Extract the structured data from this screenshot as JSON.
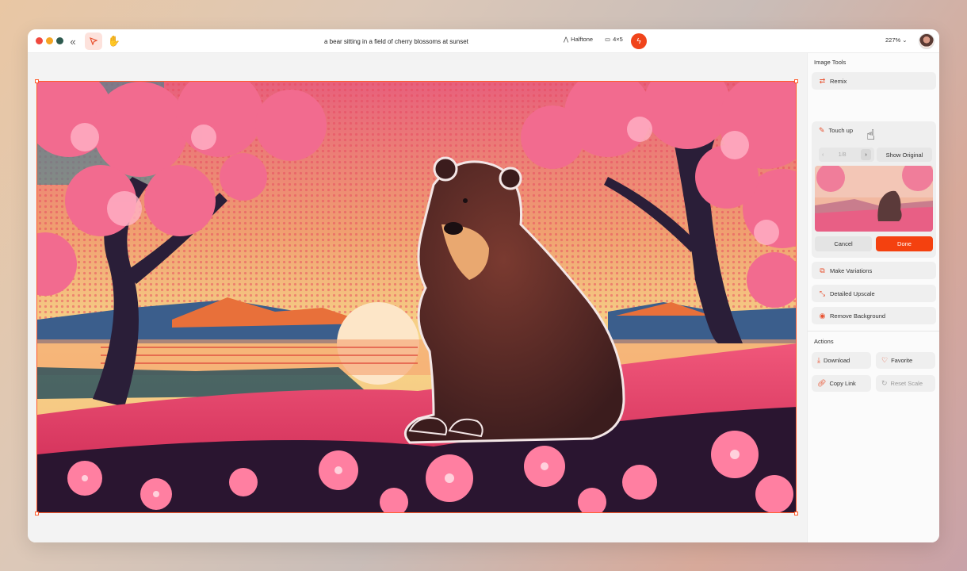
{
  "toolbar": {
    "prompt": "a bear sitting in a field of cherry blossoms at sunset",
    "style_label": "Halftone",
    "ratio_label": "4×5",
    "zoom_label": "227%",
    "collapse_icon": "double-chevron-left-icon",
    "select_icon": "cursor-arrow-icon",
    "hand_icon": "hand-icon",
    "generate_icon": "lightning-icon"
  },
  "image_tools": {
    "title": "Image Tools",
    "remix_label": "Remix",
    "touch_up": {
      "label": "Touch up",
      "pager_text": "1/8",
      "show_original_label": "Show Original",
      "cancel_label": "Cancel",
      "done_label": "Done"
    },
    "make_variations_label": "Make Variations",
    "detailed_upscale_label": "Detailed Upscale",
    "remove_background_label": "Remove Background"
  },
  "actions": {
    "title": "Actions",
    "download_label": "Download",
    "favorite_label": "Favorite",
    "copy_link_label": "Copy Link",
    "reset_scale_label": "Reset Scale"
  },
  "colors": {
    "accent": "#f0441b",
    "selection": "#ff5a2a"
  }
}
